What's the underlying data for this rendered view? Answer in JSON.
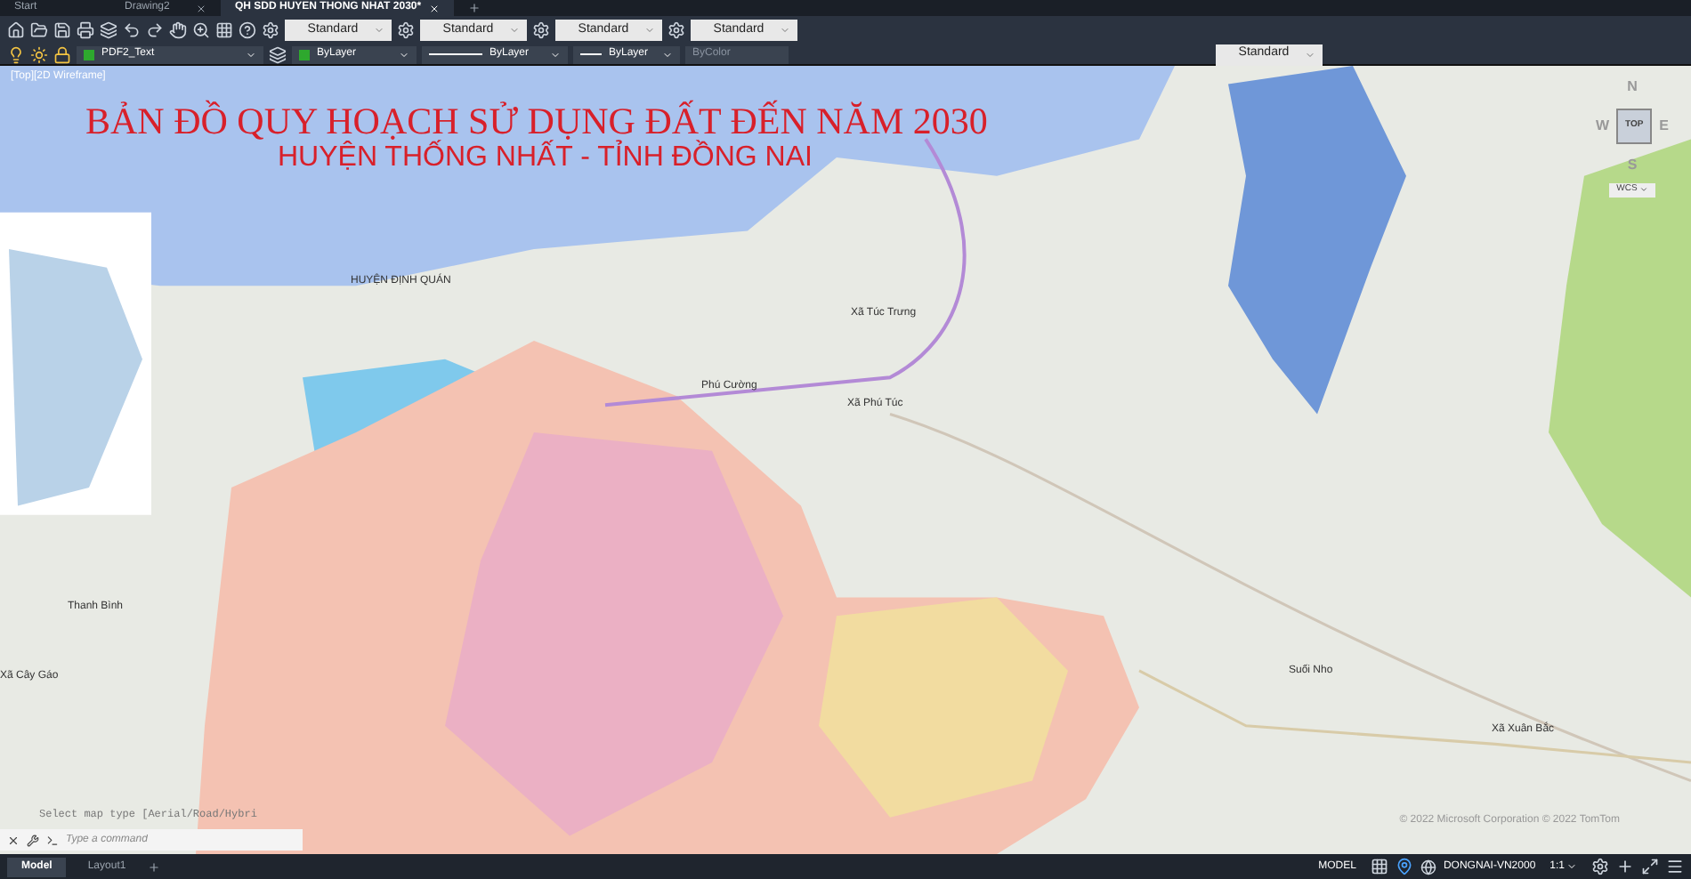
{
  "file_tabs": [
    {
      "label": "Start",
      "selected": false,
      "closable": false
    },
    {
      "label": "Drawing2",
      "selected": false,
      "closable": true
    },
    {
      "label": "QH SDD HUYEN THONG NHAT 2030*",
      "selected": true,
      "closable": true
    }
  ],
  "toolbar_row1": {
    "dropdowns": [
      "Standard",
      "Standard",
      "Standard",
      "Standard"
    ]
  },
  "toolbar_row2": {
    "layer": "PDF2_Text",
    "color_dropdown": "ByLayer",
    "linetype": "ByLayer",
    "lineweight": "ByLayer",
    "plot_style": "ByColor",
    "dim_style": "Standard"
  },
  "viewport": {
    "label": "[Top][2D Wireframe]",
    "title": "BẢN ĐỒ QUY HOẠCH SỬ DỤNG ĐẤT ĐẾN NĂM 2030",
    "subtitle": "HUYỆN THỐNG NHẤT - TỈNH ĐỒNG NAI",
    "map_labels": [
      "HUYỆN ĐỊNH QUÁN",
      "Xã Túc Trưng",
      "Phú Cường",
      "Xã Phú Túc",
      "Thanh Bình",
      "Xã Cây Gáo",
      "Suối Nho",
      "Xã Xuân Bắc"
    ],
    "attribution": "© 2022 Microsoft Corporation © 2022 TomTom"
  },
  "viewcube": {
    "north": "N",
    "west": "W",
    "east": "E",
    "south": "S",
    "face": "TOP",
    "ucs": "WCS"
  },
  "command_line": {
    "history": "Select map type [Aerial/Road/Hybri",
    "placeholder": "Type a command"
  },
  "layout_tabs": [
    {
      "label": "Model",
      "selected": true
    },
    {
      "label": "Layout1",
      "selected": false
    }
  ],
  "status_bar": {
    "mode": "MODEL",
    "coordinate_system": "DONGNAI-VN2000",
    "scale": "1:1"
  }
}
